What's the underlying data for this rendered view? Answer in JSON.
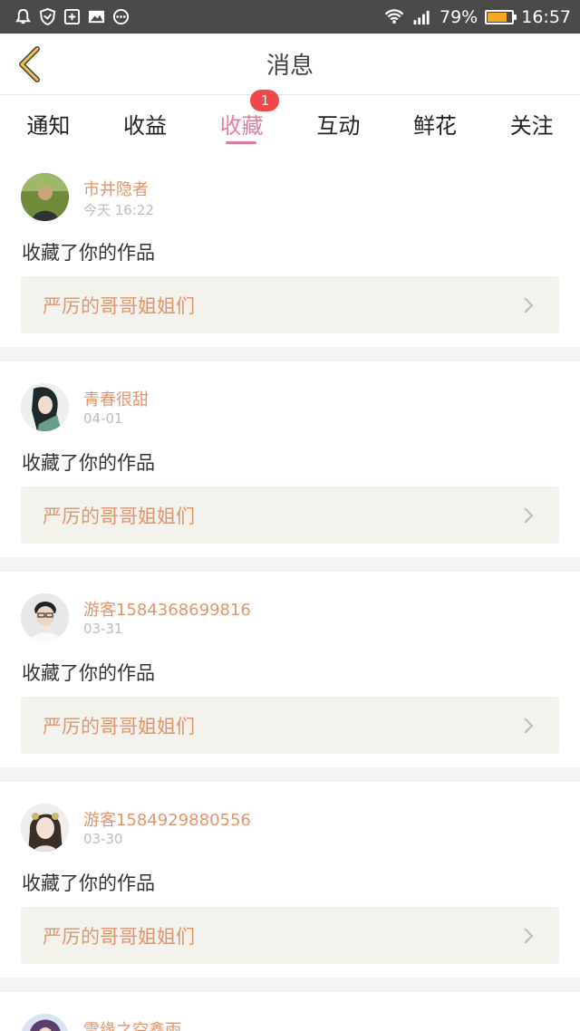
{
  "statusbar": {
    "battery_percent": "79%",
    "battery_level": 0.79,
    "time": "16:57"
  },
  "header": {
    "title": "消息"
  },
  "tabs": [
    {
      "label": "通知",
      "active": false
    },
    {
      "label": "收益",
      "active": false
    },
    {
      "label": "收藏",
      "active": true,
      "badge": "1"
    },
    {
      "label": "互动",
      "active": false
    },
    {
      "label": "鲜花",
      "active": false
    },
    {
      "label": "关注",
      "active": false
    }
  ],
  "feed": [
    {
      "name": "市井隐者",
      "time": "今天 16:22",
      "action": "收藏了你的作品",
      "work": "严厉的哥哥姐姐们"
    },
    {
      "name": "青春很甜",
      "time": "04-01",
      "action": "收藏了你的作品",
      "work": "严厉的哥哥姐姐们"
    },
    {
      "name": "游客1584368699816",
      "time": "03-31",
      "action": "收藏了你的作品",
      "work": "严厉的哥哥姐姐们"
    },
    {
      "name": "游客1584929880556",
      "time": "03-30",
      "action": "收藏了你的作品",
      "work": "严厉的哥哥姐姐们"
    },
    {
      "name": "雪缘之空鑫雨"
    }
  ],
  "colors": {
    "accent_pink": "#e47aa2",
    "name_orange": "#e2956b",
    "badge_red": "#f04848",
    "statusbar_bg": "#4a4a4a"
  }
}
